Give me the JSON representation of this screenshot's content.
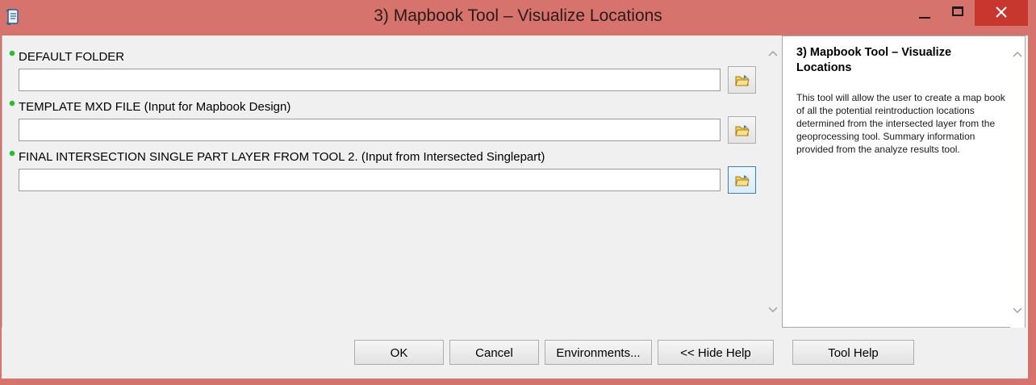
{
  "window": {
    "title": "3) Mapbook Tool – Visualize Locations",
    "icons": {
      "app": "script-tool-icon",
      "minimize": "minimize-icon",
      "maximize": "maximize-icon",
      "close": "close-icon"
    }
  },
  "params": [
    {
      "label": "DEFAULT FOLDER",
      "value": "",
      "required": true
    },
    {
      "label": "TEMPLATE MXD FILE (Input for Mapbook Design)",
      "value": "",
      "required": true
    },
    {
      "label": "FINAL INTERSECTION  SINGLE PART LAYER FROM TOOL 2. (Input from Intersected Singlepart)",
      "value": "",
      "required": true
    }
  ],
  "help": {
    "title": "3) Mapbook Tool – Visualize Locations",
    "text": "This tool will allow the user to create a map book of all the potential reintroduction locations determined from the intersected layer from the geoprocessing tool. Summary information provided from the analyze results tool."
  },
  "buttons": {
    "ok": "OK",
    "cancel": "Cancel",
    "environments": "Environments...",
    "hide_help": "<< Hide Help",
    "tool_help": "Tool Help"
  },
  "colors": {
    "title_bar": "#d5736c",
    "close_button": "#c7372d",
    "required_dot": "#1ec51e"
  }
}
